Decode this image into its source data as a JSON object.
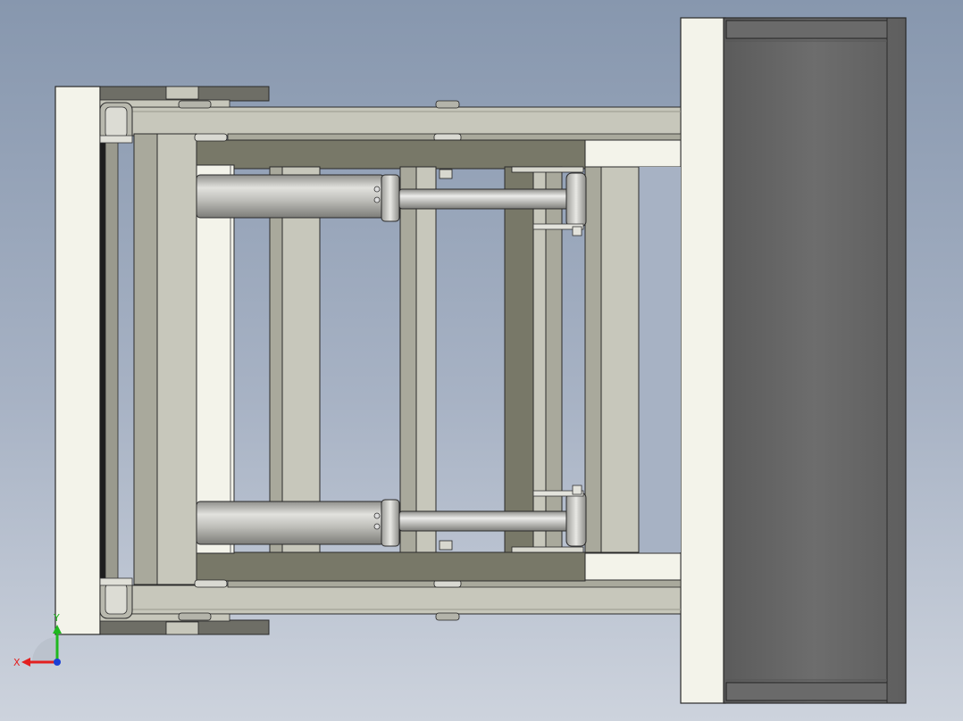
{
  "viewport": {
    "background_top": "#8797ae",
    "background_bottom": "#cdd3dd"
  },
  "triad": {
    "x_label": "X",
    "y_label": "Y",
    "x_color": "#e32020",
    "y_color": "#1fb81f",
    "z_color": "#1a3fd6"
  },
  "model": {
    "type": "hydraulic-clamp-assembly",
    "view": "top",
    "colors": {
      "frame_light": "#c7c7bb",
      "frame_mid": "#a9a99c",
      "frame_dark": "#787868",
      "plate_white": "#f3f3ea",
      "pad_dark": "#6a6a6a",
      "cylinder": "#c3c3bf",
      "outline": "#2a2a2a"
    },
    "hydraulic_cylinders": 2
  }
}
